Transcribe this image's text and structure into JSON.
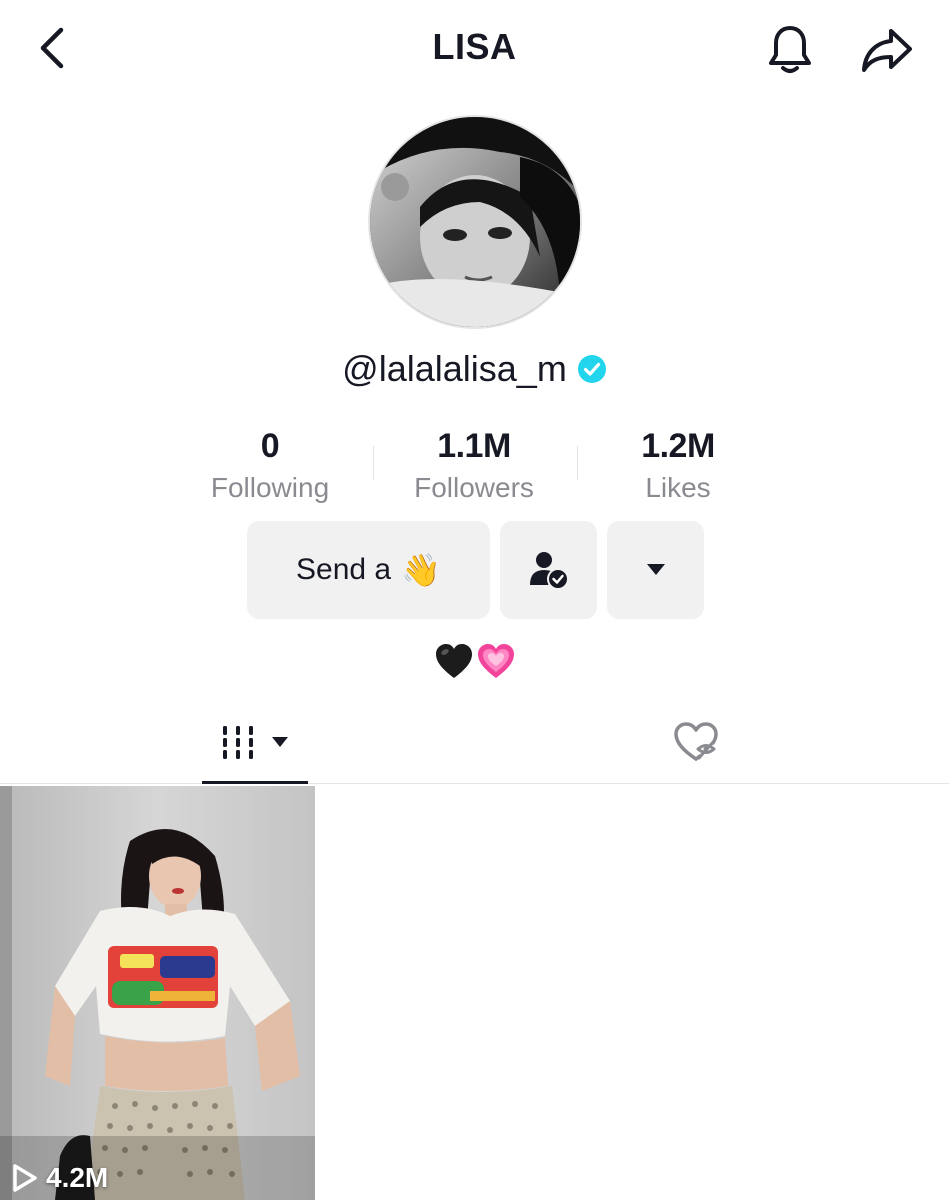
{
  "header": {
    "title": "LISA",
    "back_icon": "chevron-left-icon",
    "bell_icon": "bell-icon",
    "share_icon": "share-arrow-icon"
  },
  "profile": {
    "username": "@lalalalisa_m",
    "verified": true,
    "verified_color": "#20d5ec",
    "avatar_alt": "profile-photo"
  },
  "stats": {
    "following": {
      "value": "0",
      "label": "Following"
    },
    "followers": {
      "value": "1.1M",
      "label": "Followers"
    },
    "likes": {
      "value": "1.2M",
      "label": "Likes"
    }
  },
  "actions": {
    "send_wave_label": "Send a",
    "send_wave_emoji": "👋",
    "friend_icon": "person-check-icon",
    "more_icon": "caret-down-icon"
  },
  "bio": {
    "emoji_1": "🖤",
    "emoji_2": "💗"
  },
  "tabs": {
    "videos_icon": "grid-columns-icon",
    "videos_dropdown_icon": "caret-down-icon",
    "liked_icon": "heart-hidden-icon"
  },
  "videos": [
    {
      "views": "4.2M",
      "play_icon": "play-icon"
    }
  ],
  "colors": {
    "text": "#161823",
    "muted": "#8a8b91",
    "button_bg": "#f1f1f2",
    "divider": "#e6e6e7"
  }
}
